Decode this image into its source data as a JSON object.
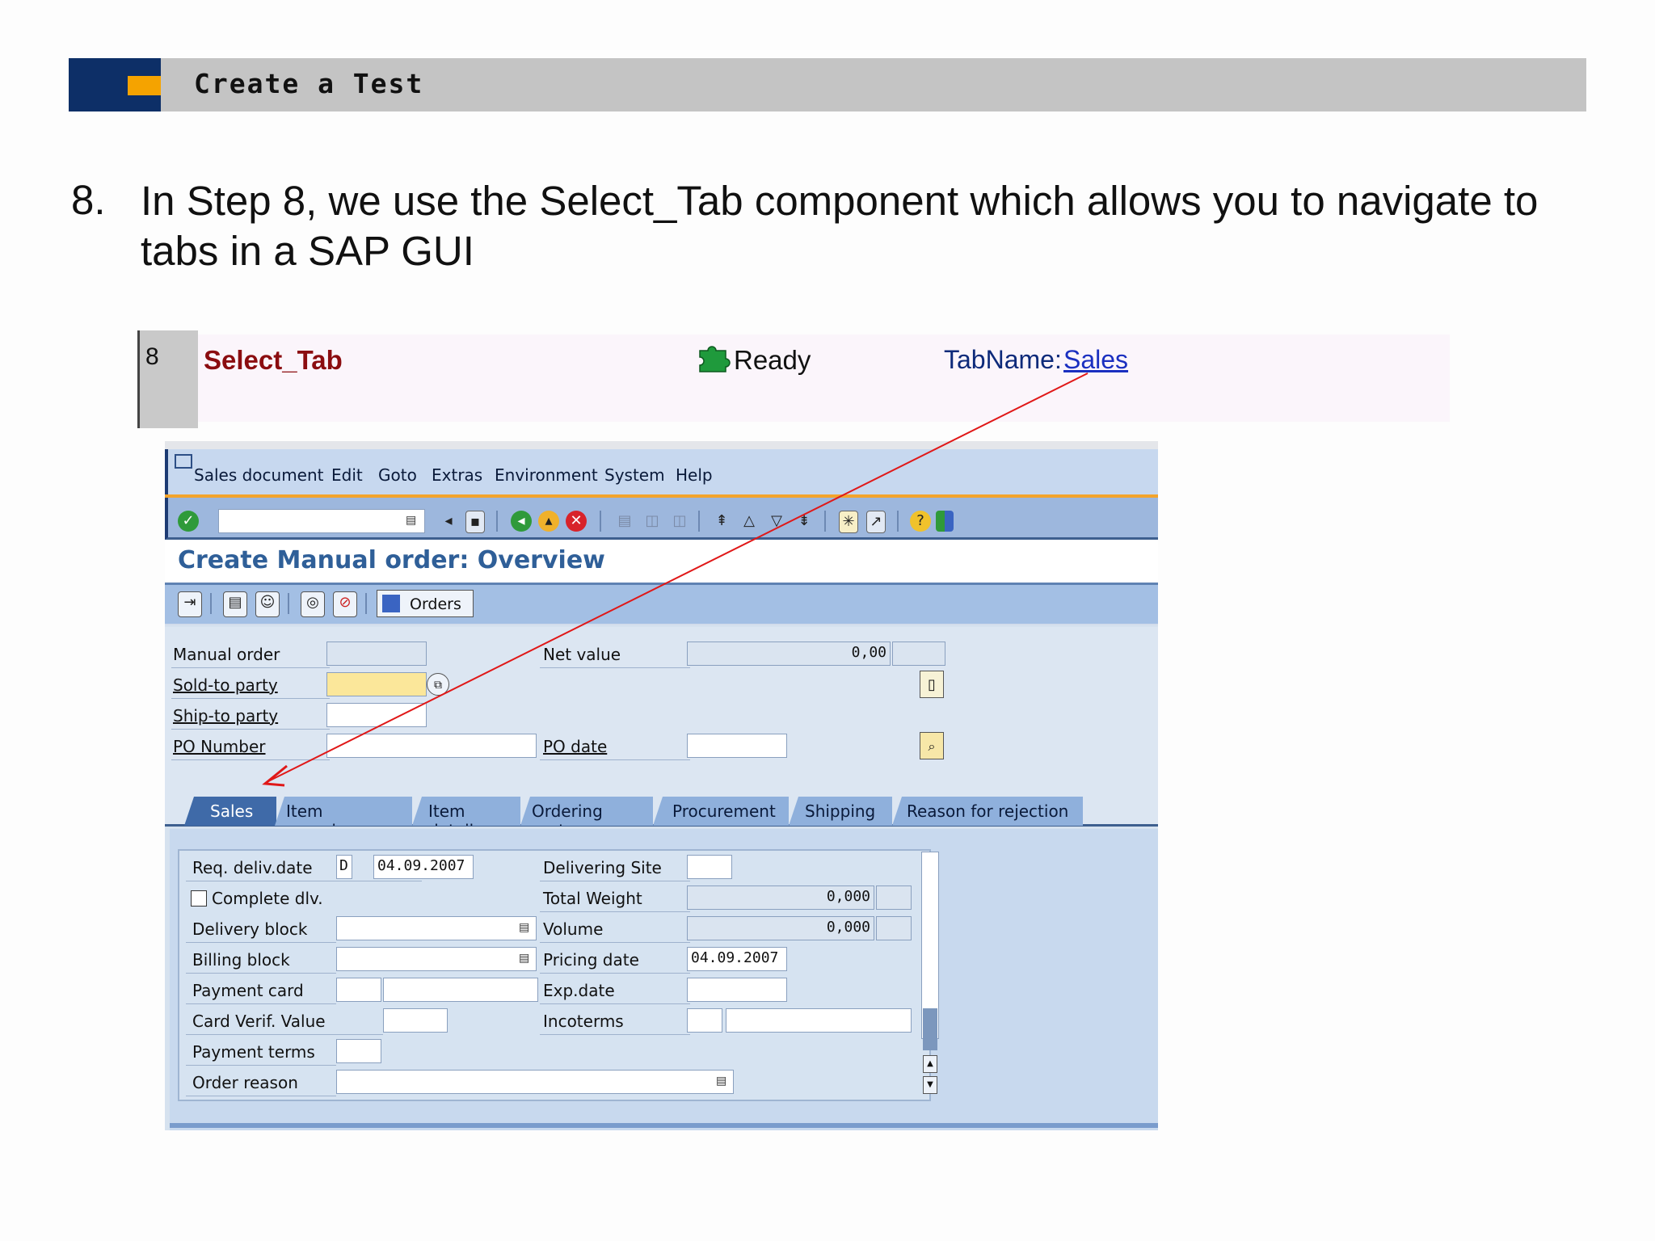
{
  "slide": {
    "title": "Create a Test",
    "step_number": "8.",
    "step_text": "In Step 8, we use the Select_Tab  component which allows you to navigate to tabs in a SAP GUI"
  },
  "test_row": {
    "number": "8",
    "component": "Select_Tab",
    "status": "Ready",
    "param_label": "TabName:",
    "param_value": "Sales"
  },
  "sap": {
    "menu": [
      "Sales document",
      "Edit",
      "Goto",
      "Extras",
      "Environment",
      "System",
      "Help"
    ],
    "toolbar_icons": [
      "enter-icon",
      "back-icon",
      "save-icon",
      "back-green-icon",
      "exit-icon",
      "cancel-icon",
      "print-icon",
      "find-icon",
      "find-next-icon",
      "first-page-icon",
      "prev-page-icon",
      "next-page-icon",
      "last-page-icon",
      "create-session-icon",
      "shortcut-icon",
      "help-icon",
      "layout-icon"
    ],
    "title": "Create Manual order: Overview",
    "app_toolbar": {
      "orders_label": "Orders"
    },
    "header": {
      "manual_order_label": "Manual order",
      "manual_order_value": "",
      "net_value_label": "Net value",
      "net_value_value": "0,00",
      "sold_to_label": "Sold-to party",
      "sold_to_value": "",
      "ship_to_label": "Ship-to party",
      "ship_to_value": "",
      "po_number_label": "PO Number",
      "po_number_value": "",
      "po_date_label": "PO date",
      "po_date_value": ""
    },
    "tabs": [
      "Sales",
      "Item overview",
      "Item detail",
      "Ordering party",
      "Procurement",
      "Shipping",
      "Reason for rejection"
    ],
    "active_tab": "Sales",
    "sales": {
      "req_deliv_label": "Req. deliv.date",
      "req_deliv_unit": "D",
      "req_deliv_value": "04.09.2007",
      "delivering_site_label": "Delivering Site",
      "complete_dlv_label": "Complete dlv.",
      "total_weight_label": "Total Weight",
      "total_weight_value": "0,000",
      "delivery_block_label": "Delivery block",
      "volume_label": "Volume",
      "volume_value": "0,000",
      "billing_block_label": "Billing block",
      "pricing_date_label": "Pricing date",
      "pricing_date_value": "04.09.2007",
      "payment_card_label": "Payment card",
      "exp_date_label": "Exp.date",
      "card_verif_label": "Card Verif. Value",
      "incoterms_label": "Incoterms",
      "payment_terms_label": "Payment terms",
      "order_reason_label": "Order reason"
    }
  },
  "colors": {
    "header_navy": "#0d2f67",
    "header_orange": "#f5a300",
    "component_red": "#8b0d10",
    "sap_blue": "#3f6aa8",
    "arrow_red": "#e01818"
  }
}
